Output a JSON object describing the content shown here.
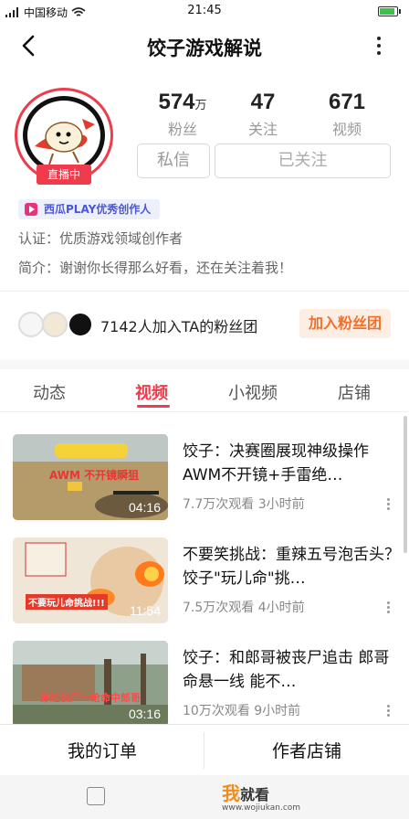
{
  "status_bar": {
    "carrier": "中国移动",
    "time": "21:45"
  },
  "nav": {
    "title": "饺子游戏解说"
  },
  "profile": {
    "live_badge": "直播中",
    "stats": [
      {
        "num": "574",
        "unit": "万",
        "label": "粉丝"
      },
      {
        "num": "47",
        "unit": "",
        "label": "关注"
      },
      {
        "num": "671",
        "unit": "",
        "label": "视频"
      }
    ],
    "message_button": "私信",
    "follow_button": "已关注",
    "creator_badge": "西瓜PLAY优秀创作人",
    "certification": "认证：优质游戏领域创作者",
    "bio": "简介：谢谢你长得那么好看，还在关注着我！"
  },
  "fan_club": {
    "text": "7142人加入TA的粉丝团",
    "join_button": "加入粉丝团"
  },
  "tabs": [
    "动态",
    "视频",
    "小视频",
    "店铺"
  ],
  "active_tab_index": 1,
  "videos": [
    {
      "title": "饺子：决赛圈展现神级操作 AWM不开镜+手雷绝…",
      "meta": "7.7万次观看 3小时前",
      "duration": "04:16",
      "thumb_text": "AWM 不开镜瞬狙"
    },
    {
      "title": "不要笑挑战：重辣五号泡舌头？饺子\"玩儿命\"挑…",
      "meta": "7.5万次观看 4小时前",
      "duration": "11:54",
      "thumb_text": "不要玩儿命挑战!!!"
    },
    {
      "title": "饺子：和郎哥被丧尸追击 郎哥命悬一线 能不…",
      "meta": "10万次观看 9小时前",
      "duration": "03:16",
      "thumb_text": "穿过丧尸一枪命中郎哥"
    }
  ],
  "bottom_bar": {
    "left": "我的订单",
    "right": "作者店铺"
  },
  "watermark": {
    "brand_a": "我",
    "brand_b": "就看",
    "url": "www.wojiukan.com"
  }
}
